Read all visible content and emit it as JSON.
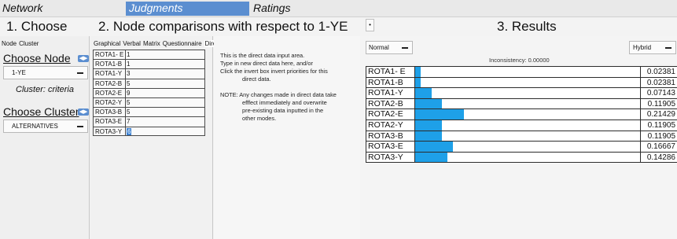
{
  "tabs": [
    "Network",
    "Judgments",
    "Ratings"
  ],
  "headings": {
    "choose": "1. Choose",
    "comparisons": "2. Node comparisons with respect to 1-YE",
    "results": "3. Results"
  },
  "left": {
    "mini_tabs": [
      "Node",
      "Cluster"
    ],
    "choose_node": "Choose Node",
    "node_value": "1-YE",
    "cluster_caption": "Cluster: criteria",
    "choose_cluster": "Choose Cluster",
    "cluster_value": "ALTERNATIVES"
  },
  "mid": {
    "mini_tabs": [
      "Graphical",
      "Verbal",
      "Matrix",
      "Questionnaire",
      "Direct"
    ],
    "rows": [
      {
        "label": "ROTA1- E",
        "value": "1"
      },
      {
        "label": "ROTA1-B",
        "value": "1"
      },
      {
        "label": "ROTA1-Y",
        "value": "3"
      },
      {
        "label": "ROTA2-B",
        "value": "5"
      },
      {
        "label": "ROTA2-E",
        "value": "9"
      },
      {
        "label": "ROTA2-Y",
        "value": "5"
      },
      {
        "label": "ROTA3-B",
        "value": "5"
      },
      {
        "label": "ROTA3-E",
        "value": "7"
      },
      {
        "label": "ROTA3-Y",
        "value": "6"
      }
    ]
  },
  "direct": {
    "line1": "This is the direct data input area.",
    "line2": "Type in new direct data here, and/or",
    "line3": "Click the invert box invert priorities for this",
    "line4": "direct data.",
    "note1": "NOTE: Any changes made in direct data take",
    "note2": "efffect immediately and overwrite",
    "note3": "pre-existing data inputted in the",
    "note4": "other modes."
  },
  "results": {
    "mode_left": "Normal",
    "mode_right": "Hybrid",
    "inconsistency": "Inconsistency: 0.00000",
    "bar_color": "#1ea0e8",
    "rows": [
      {
        "name": "ROTA1- E",
        "value": "0.02381",
        "priority": 0.02381
      },
      {
        "name": "ROTA1-B",
        "value": "0.02381",
        "priority": 0.02381
      },
      {
        "name": "ROTA1-Y",
        "value": "0.07143",
        "priority": 0.07143
      },
      {
        "name": "ROTA2-B",
        "value": "0.11905",
        "priority": 0.11905
      },
      {
        "name": "ROTA2-E",
        "value": "0.21429",
        "priority": 0.21429
      },
      {
        "name": "ROTA2-Y",
        "value": "0.11905",
        "priority": 0.11905
      },
      {
        "name": "ROTA3-B",
        "value": "0.11905",
        "priority": 0.11905
      },
      {
        "name": "ROTA3-E",
        "value": "0.16667",
        "priority": 0.16667
      },
      {
        "name": "ROTA3-Y",
        "value": "0.14286",
        "priority": 0.14286
      }
    ]
  }
}
